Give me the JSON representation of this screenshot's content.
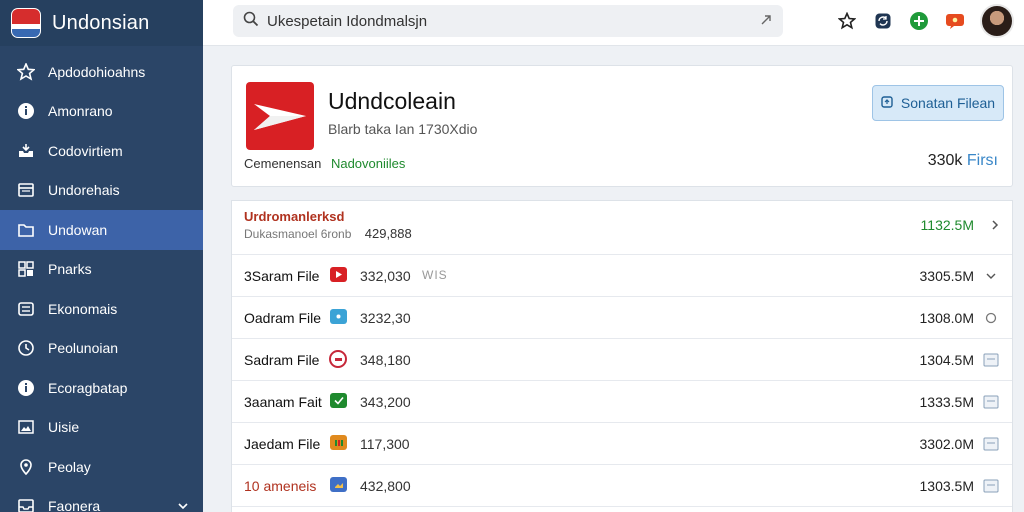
{
  "app": {
    "brand_name": "Undonsian"
  },
  "search": {
    "value": "Ukespetain Idondmalsjn",
    "placeholder": ""
  },
  "sidebar": {
    "items": [
      {
        "label": "Apdodohioahns",
        "icon": "star-icon"
      },
      {
        "label": "Amonrano",
        "icon": "info-icon"
      },
      {
        "label": "Codovirtiem",
        "icon": "tray-icon"
      },
      {
        "label": "Undorehais",
        "icon": "window-icon"
      },
      {
        "label": "Undowan",
        "icon": "folder-icon",
        "active": true
      },
      {
        "label": "Pnarks",
        "icon": "grid-icon"
      },
      {
        "label": "Ekonomais",
        "icon": "card-icon"
      },
      {
        "label": "Peolunoian",
        "icon": "clock-icon"
      },
      {
        "label": "Ecoragbatap",
        "icon": "info-icon"
      },
      {
        "label": "Uisie",
        "icon": "image-icon"
      },
      {
        "label": "Peolay",
        "icon": "location-icon"
      },
      {
        "label": "Faonera",
        "icon": "inbox-icon",
        "expandable": true
      }
    ]
  },
  "header": {
    "title": "Udndcoleain",
    "subtitle": "Blarb taka Ian 1730Xdio",
    "meta_label": "Cemenensan",
    "meta_value": "Nadovoniiles",
    "button_label": "Sonatan Filean",
    "count_value": "330k",
    "count_unit": "Firsı"
  },
  "list": {
    "head": {
      "title": "Urdromanlerksd",
      "desc": "Dukasmanoel 6ronb",
      "num": "429,888",
      "size": "1132.5M"
    },
    "rows": [
      {
        "name": "3Saram File",
        "num": "332,030",
        "ext": "WIS",
        "size": "3305.5M",
        "icon_color": "#d82024",
        "action": "chevron"
      },
      {
        "name": "Oadram File",
        "num": "3232,30",
        "ext": "",
        "size": "1308.0M",
        "icon_color": "#3ba3d6",
        "action": "circle"
      },
      {
        "name": "Sadram File",
        "num": "348,180",
        "ext": "",
        "size": "1304.5M",
        "icon_color": "#c6283a",
        "action": "box"
      },
      {
        "name": "3aanam Fait",
        "num": "343,200",
        "ext": "",
        "size": "1333.5M",
        "icon_color": "#1f8a2e",
        "action": "box"
      },
      {
        "name": "Jaedam File",
        "num": "117,300",
        "ext": "",
        "size": "3302.0M",
        "icon_color": "#e08a1e",
        "action": "box"
      },
      {
        "name": "10 ameneis",
        "num": "432,800",
        "ext": "",
        "size": "1303.5M",
        "icon_color": "#3f6fc6",
        "action": "box"
      }
    ]
  },
  "colors": {
    "sidebar": "#2b4567",
    "sidebar_active": "#3d63a8",
    "accent_blue": "#3a87c8",
    "green": "#1f8a2e",
    "red": "#d82024"
  }
}
